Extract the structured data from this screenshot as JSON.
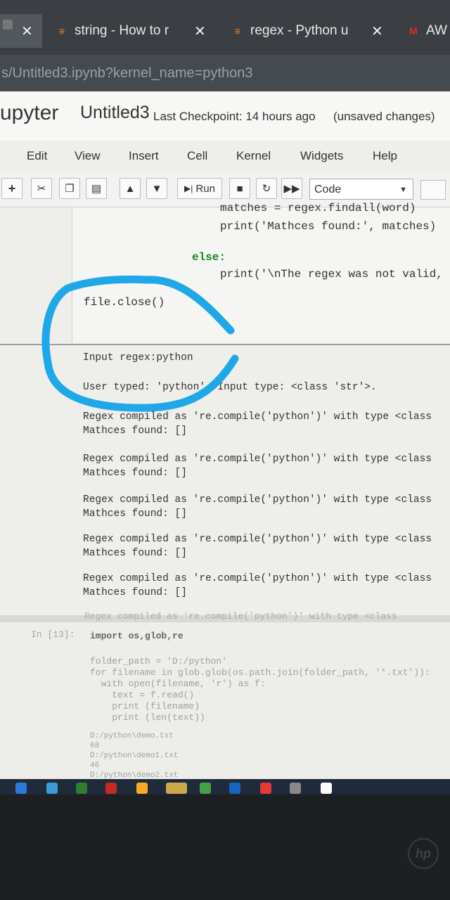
{
  "browser": {
    "tabs": [
      {
        "title": "",
        "icon": "close-icon"
      },
      {
        "title": "string - How to r",
        "icon": "stackoverflow-icon"
      },
      {
        "title": "regex - Python u",
        "icon": "stackoverflow-icon"
      },
      {
        "title": "AW",
        "icon": "gmail-icon"
      }
    ],
    "url": "s/Untitled3.ipynb?kernel_name=python3"
  },
  "jupyter": {
    "logo": "upyter",
    "notebook_name": "Untitled3",
    "checkpoint": "Last Checkpoint: 14 hours ago",
    "unsaved": "(unsaved changes)",
    "menu": [
      "Edit",
      "View",
      "Insert",
      "Cell",
      "Kernel",
      "Widgets",
      "Help"
    ],
    "toolbar": {
      "run_label": "Run",
      "cell_type": "Code",
      "icons": [
        "plus-icon",
        "cut-icon",
        "copy-icon",
        "paste-icon",
        "up-arrow-icon",
        "down-arrow-icon",
        "run-icon",
        "stop-icon",
        "restart-icon",
        "fast-forward-icon",
        "keyboard-icon"
      ]
    }
  },
  "code_cell": {
    "lines": [
      "matches = regex.findall(word)",
      "print('Mathces found:', matches)",
      "else:",
      "print('\\nThe regex was not valid,",
      "file.close()"
    ]
  },
  "output": {
    "input_line": "Input regex:python",
    "typed_line": "User typed: 'python'. Input type: <class 'str'>.",
    "blocks": [
      {
        "compiled": "Regex compiled as 're.compile('python')' with type <class",
        "found": "Mathces found: []"
      },
      {
        "compiled": "Regex compiled as 're.compile('python')' with type <class",
        "found": "Mathces found: []"
      },
      {
        "compiled": "Regex compiled as 're.compile('python')' with type <class",
        "found": "Mathces found: []"
      },
      {
        "compiled": "Regex compiled as 're.compile('python')' with type <class",
        "found": "Mathces found: []"
      },
      {
        "compiled": "Regex compiled as 're.compile('python')' with type <class",
        "found": "Mathces found: []"
      }
    ],
    "cut_line": "Regex compiled as 're.compile('python')' with type <class"
  },
  "cell2": {
    "prompt": "In [13]:",
    "lines": [
      "import os,glob,re",
      "",
      "folder_path = 'D:/python'",
      "for filename in glob.glob(os.path.join(folder_path, '*.txt')):",
      "  with open(filename, 'r') as f:",
      "    text = f.read()",
      "    print (filename)",
      "    print (len(text))"
    ],
    "outputs": [
      "D:/python\\demo.txt",
      "68",
      "D:/python\\demo1.txt",
      "46",
      "D:/python\\demo2.txt"
    ]
  },
  "colors": {
    "annotation": "#1fa8e8",
    "keyword": "#188a1e",
    "string": "#b22222"
  },
  "laptop": {
    "brand": "hp"
  }
}
